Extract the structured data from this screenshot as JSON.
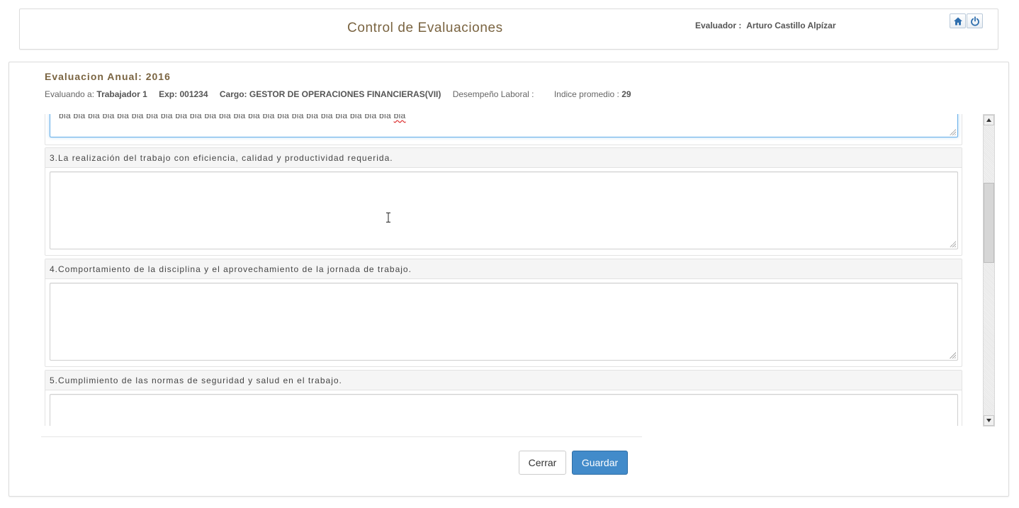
{
  "header": {
    "title": "Control de Evaluaciones",
    "evaluador_label": "Evaluador :",
    "evaluador_name": "Arturo Castillo Alpízar"
  },
  "evaluation": {
    "title": "Evaluacion Anual:  2016",
    "evaluando_label": "Evaluando a:",
    "evaluando_value": "Trabajador 1",
    "exp_label": "Exp:",
    "exp_value": "001234",
    "cargo_label": "Cargo:",
    "cargo_value": "GESTOR DE OPERACIONES FINANCIERAS(VII)",
    "desempeno_label": "Desempeño Laboral :",
    "indice_label": "Indice promedio :",
    "indice_value": "29"
  },
  "previous_answer": {
    "text": "bla bla bla bla bla bla bla bla bla bla bla bla bla bla bla bla bla bla bla bla bla bla bla",
    "last_word": "bla"
  },
  "questions": [
    {
      "label": "3.La realización del trabajo con eficiencia, calidad y productividad requerida.",
      "value": ""
    },
    {
      "label": "4.Comportamiento de la disciplina y el aprovechamiento de la jornada de trabajo.",
      "value": ""
    },
    {
      "label": "5.Cumplimiento de las normas de seguridad y salud en el trabajo.",
      "value": ""
    }
  ],
  "actions": {
    "cerrar": "Cerrar",
    "guardar": "Guardar"
  },
  "icons": {
    "home": "home-icon",
    "power": "power-icon"
  },
  "colors": {
    "title_brown": "#7a6441",
    "primary_button": "#428bca",
    "focus_border": "#66afe9"
  },
  "scroll": {
    "position_fraction": 0.35
  }
}
